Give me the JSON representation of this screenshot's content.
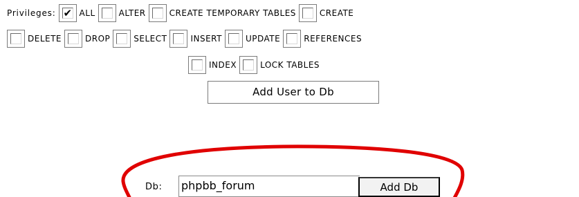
{
  "privileges": {
    "title": "Privileges:",
    "items": [
      {
        "label": "ALL",
        "checked": true
      },
      {
        "label": "ALTER",
        "checked": false
      },
      {
        "label": "CREATE TEMPORARY TABLES",
        "checked": false
      },
      {
        "label": "CREATE",
        "checked": false
      },
      {
        "label": "DELETE",
        "checked": false
      },
      {
        "label": "DROP",
        "checked": false
      },
      {
        "label": "SELECT",
        "checked": false
      },
      {
        "label": "INSERT",
        "checked": false
      },
      {
        "label": "UPDATE",
        "checked": false
      },
      {
        "label": "REFERENCES",
        "checked": false
      },
      {
        "label": "INDEX",
        "checked": false
      },
      {
        "label": "LOCK TABLES",
        "checked": false
      }
    ]
  },
  "add_user_button": "Add User to Db",
  "db": {
    "label": "Db:",
    "value": "phpbb_forum",
    "button": "Add Db"
  },
  "annotation_color": "#e00000"
}
